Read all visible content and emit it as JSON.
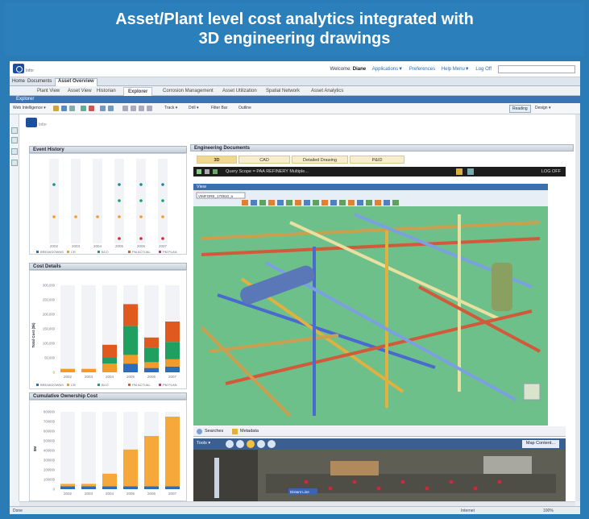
{
  "banner": {
    "line1": "Asset/Plant level cost analytics integrated with",
    "line2": "3D engineering drawings"
  },
  "header": {
    "logo_text": "Infor",
    "welcome_prefix": "Welcome:",
    "user": "Diane",
    "links": [
      "Applications▼",
      "Preferences",
      "Help Menu▼",
      "Log Off"
    ]
  },
  "nav_tabs": [
    "Home",
    "Documents",
    "Asset Overview"
  ],
  "sub_tabs": [
    "Plant View",
    "Asset View",
    "Historian",
    "Explorer",
    "Corrosion Management",
    "Asset Utilization",
    "Spatial Network",
    "Asset Analytics"
  ],
  "active_sub_tab": "Explorer",
  "explorer_bar": "Explorer",
  "toolbar": {
    "web_intelligence": "Web Intelligence ▾",
    "track": "Track ▾",
    "drill": "Drill ▾",
    "filter_bar": "Filter Bar",
    "outline": "Outline",
    "reading": "Reading",
    "design": "Design ▾"
  },
  "event_history": {
    "title": "Event History",
    "years": [
      "2002",
      "2003",
      "2004",
      "2005",
      "2006",
      "2007"
    ],
    "legend": [
      "BREAKDOWNS",
      "CR",
      "BCO",
      "PM ACTUAL",
      "PM PLAN"
    ],
    "colors": {
      "orange": "#f39a2b",
      "teal": "#1e8aa0",
      "green": "#20a060",
      "red": "#d02838",
      "pink": "#d03078",
      "blue": "#2e6cb8"
    }
  },
  "cost_details": {
    "title": "Cost Details",
    "ylabel": "Total Cost ($k)",
    "yticks": [
      "300,000",
      "250,000",
      "200,000",
      "150,000",
      "100,000",
      "50,000",
      "0"
    ],
    "years": [
      "2002",
      "2003",
      "2004",
      "2005",
      "2006",
      "2007"
    ],
    "legend": [
      "BREAKDOWNS",
      "CR",
      "BCO",
      "PM ACTUAL",
      "PM PLAN"
    ]
  },
  "ownership": {
    "title": "Cumulative Ownership Cost",
    "ylabel": "$M",
    "yticks": [
      "800000",
      "700000",
      "600000",
      "500000",
      "400000",
      "300000",
      "200000",
      "100000",
      "0"
    ],
    "years": [
      "2002",
      "2003",
      "2004",
      "2005",
      "2006",
      "2007"
    ]
  },
  "engineering": {
    "title": "Engineering Documents",
    "tabs": [
      "3D",
      "CAD",
      "Detailed Drawing",
      "P&ID"
    ],
    "active_tab": "3D",
    "viewer_title": "Query Scope = PAA REFINERY Multiple...",
    "log_off": "LOG OFF",
    "view_label": "View",
    "file_tab": "VIMFORE_170810_a"
  },
  "map": {
    "tabs": [
      "Searches",
      "Metadata"
    ],
    "tools": "Tools ▾",
    "map_content": "Map Content...",
    "tag": "Distant Line"
  },
  "status": {
    "left": "Done",
    "zone": "Internet",
    "zoom": "100%"
  },
  "chart_data": [
    {
      "type": "scatter",
      "title": "Event History",
      "categories": [
        "2002",
        "2003",
        "2004",
        "2005",
        "2006",
        "2007"
      ],
      "series": [
        {
          "name": "BREAKDOWNS",
          "values": [
            null,
            null,
            null,
            1,
            1,
            1
          ]
        },
        {
          "name": "CR",
          "values": [
            1,
            1,
            1,
            1,
            1,
            1
          ]
        },
        {
          "name": "BCO",
          "values": [
            null,
            null,
            null,
            1,
            1,
            1
          ]
        },
        {
          "name": "PM ACTUAL",
          "values": [
            1,
            null,
            null,
            1,
            1,
            1
          ]
        },
        {
          "name": "PM PLAN",
          "values": [
            null,
            null,
            null,
            null,
            null,
            null
          ]
        }
      ]
    },
    {
      "type": "bar",
      "title": "Cost Details",
      "ylabel": "Total Cost ($k)",
      "categories": [
        "2002",
        "2003",
        "2004",
        "2005",
        "2006",
        "2007"
      ],
      "ylim": [
        0,
        300000
      ],
      "series": [
        {
          "name": "BREAKDOWNS",
          "values": [
            0,
            0,
            0,
            30000,
            15000,
            20000
          ]
        },
        {
          "name": "CR",
          "values": [
            12000,
            12000,
            30000,
            30000,
            20000,
            25000
          ]
        },
        {
          "name": "BCO",
          "values": [
            0,
            0,
            20000,
            100000,
            50000,
            60000
          ]
        },
        {
          "name": "PM ACTUAL",
          "values": [
            0,
            0,
            45000,
            75000,
            35000,
            70000
          ]
        },
        {
          "name": "PM PLAN",
          "values": [
            0,
            0,
            0,
            0,
            0,
            0
          ]
        }
      ]
    },
    {
      "type": "bar",
      "title": "Cumulative Ownership Cost",
      "ylabel": "$M",
      "categories": [
        "2002",
        "2003",
        "2004",
        "2005",
        "2006",
        "2007"
      ],
      "ylim": [
        0,
        800000
      ],
      "series": [
        {
          "name": "base",
          "values": [
            30000,
            30000,
            30000,
            30000,
            30000,
            30000
          ]
        },
        {
          "name": "cumulative",
          "values": [
            25000,
            25000,
            130000,
            380000,
            520000,
            720000
          ]
        }
      ]
    }
  ]
}
